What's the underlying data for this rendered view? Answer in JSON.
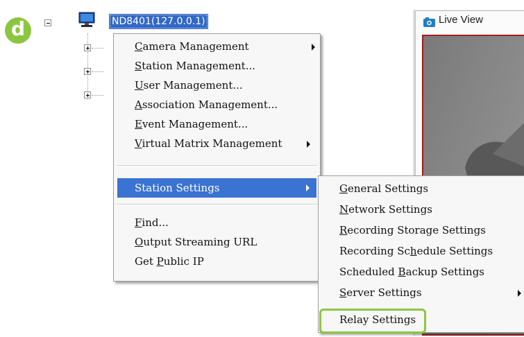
{
  "step_badge": {
    "letter": "d"
  },
  "tree": {
    "node_label": "ND8401(127.0.0.1)"
  },
  "live_view": {
    "title": "Live View"
  },
  "context_menu": {
    "items": [
      {
        "pre": "",
        "mn": "C",
        "post": "amera Management"
      },
      {
        "pre": "",
        "mn": "S",
        "post": "tation Management..."
      },
      {
        "pre": "",
        "mn": "U",
        "post": "ser Management..."
      },
      {
        "pre": "",
        "mn": "A",
        "post": "ssociation Management..."
      },
      {
        "pre": "",
        "mn": "E",
        "post": "vent Management..."
      },
      {
        "pre": "",
        "mn": "V",
        "post": "irtual Matrix Management"
      },
      {
        "pre": "Station Settings",
        "mn": "",
        "post": ""
      },
      {
        "pre": "",
        "mn": "F",
        "post": "ind..."
      },
      {
        "pre": "",
        "mn": "O",
        "post": "utput Streaming URL"
      },
      {
        "pre": "Get ",
        "mn": "P",
        "post": "ublic IP"
      }
    ]
  },
  "submenu": {
    "items": [
      {
        "pre": "",
        "mn": "G",
        "post": "eneral Settings"
      },
      {
        "pre": "",
        "mn": "N",
        "post": "etwork Settings"
      },
      {
        "pre": "",
        "mn": "R",
        "post": "ecording Storage Settings"
      },
      {
        "pre": "Recording Sc",
        "mn": "h",
        "post": "edule Settings"
      },
      {
        "pre": "Scheduled ",
        "mn": "B",
        "post": "ackup Settings"
      },
      {
        "pre": "",
        "mn": "S",
        "post": "erver Settings"
      },
      {
        "pre": "Relay Settings",
        "mn": "",
        "post": ""
      }
    ]
  },
  "colors": {
    "highlight": "#8cc640",
    "selection": "#3a73d1",
    "tree_selection": "#3268c6"
  },
  "icons": [
    "monitor-icon",
    "camera-icon",
    "submenu-arrow-icon",
    "expander-plus-icon",
    "expander-minus-icon"
  ]
}
